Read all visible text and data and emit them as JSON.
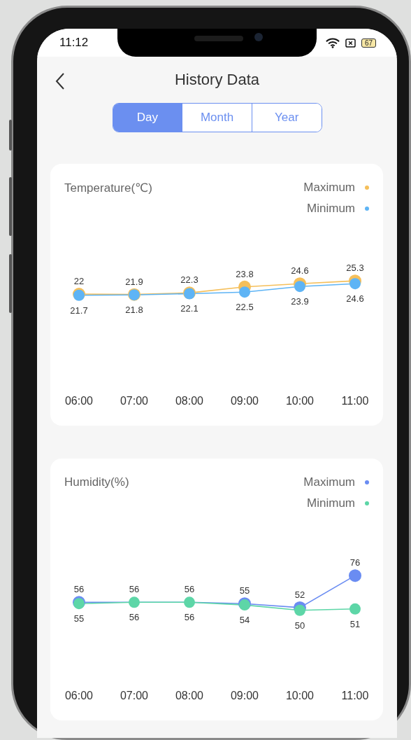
{
  "status_bar": {
    "time": "11:12",
    "battery": "67"
  },
  "header": {
    "title": "History Data"
  },
  "tabs": [
    {
      "label": "Day",
      "selected": true
    },
    {
      "label": "Month",
      "selected": false
    },
    {
      "label": "Year",
      "selected": false
    }
  ],
  "cards": [
    {
      "title": "Temperature(℃)",
      "chart_data": {
        "type": "line",
        "categories": [
          "06:00",
          "07:00",
          "08:00",
          "09:00",
          "10:00",
          "11:00"
        ],
        "data_labels": true,
        "series": [
          {
            "name": "Maximum",
            "color": "#f5bf5a",
            "marker": "circle",
            "values": [
              22,
              21.9,
              22.3,
              23.8,
              24.6,
              25.3
            ]
          },
          {
            "name": "Minimum",
            "color": "#5eb4f5",
            "marker": "circle",
            "values": [
              21.7,
              21.8,
              22.1,
              22.5,
              23.9,
              24.6
            ]
          }
        ]
      }
    },
    {
      "title": "Humidity(%)",
      "chart_data": {
        "type": "line",
        "categories": [
          "06:00",
          "07:00",
          "08:00",
          "09:00",
          "10:00",
          "11:00"
        ],
        "data_labels": true,
        "series": [
          {
            "name": "Maximum",
            "color": "#6a8cf2",
            "marker": "circle",
            "values": [
              56,
              56,
              56,
              55,
              52,
              76
            ]
          },
          {
            "name": "Minimum",
            "color": "#5dd6a7",
            "marker": "circle",
            "values": [
              55,
              56,
              56,
              54,
              50,
              51
            ]
          }
        ]
      }
    }
  ]
}
